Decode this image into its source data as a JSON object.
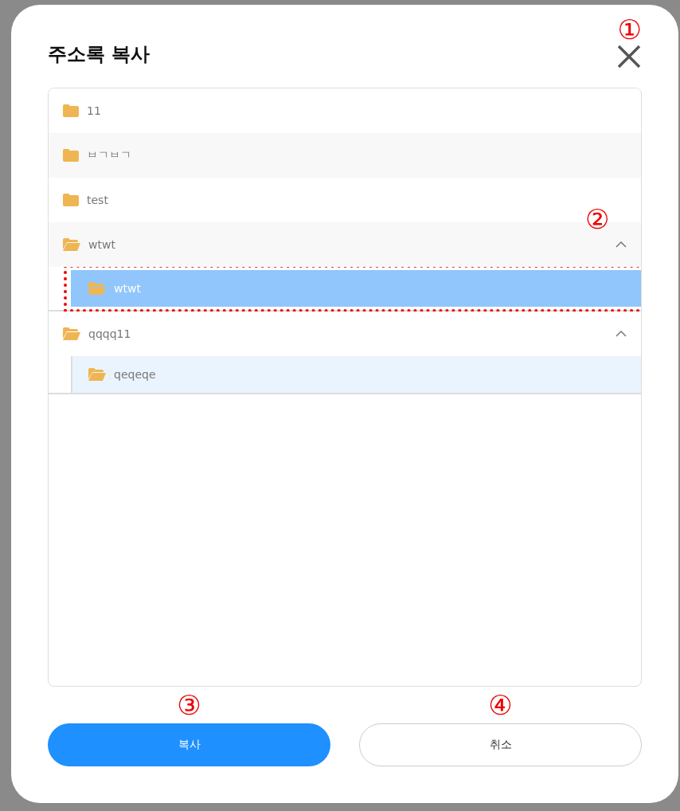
{
  "dialog": {
    "title": "주소록 복사"
  },
  "folders": [
    {
      "name": "11",
      "expanded": false
    },
    {
      "name": "ㅂㄱㅂㄱ",
      "expanded": false
    },
    {
      "name": "test",
      "expanded": false
    },
    {
      "name": "wtwt",
      "expanded": true,
      "children": [
        {
          "name": "wtwt",
          "selected": true
        }
      ]
    },
    {
      "name": "qqqq11",
      "expanded": true,
      "children": [
        {
          "name": "qeqeqe",
          "selected": false
        }
      ]
    }
  ],
  "buttons": [
    {
      "label": "복사",
      "kind": "primary"
    },
    {
      "label": "취소",
      "kind": "secondary"
    }
  ],
  "annotations": [
    "①",
    "②",
    "③",
    "④"
  ]
}
